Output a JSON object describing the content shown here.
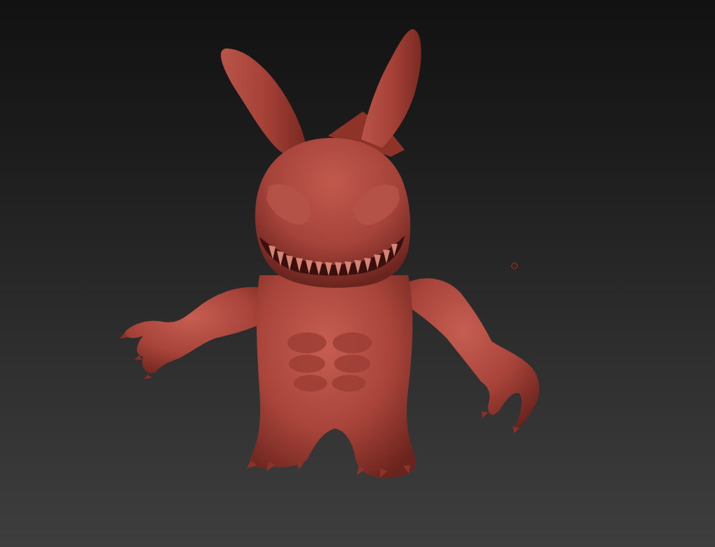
{
  "canvas": {
    "background_top": "#121212",
    "background_bottom": "#3e3e3e"
  },
  "model": {
    "material_color": "#a8443a",
    "highlight_color": "#c8665a",
    "shadow_color": "#5a1d18",
    "mouth_color": "#2a0a08",
    "teeth_color": "#d88a7a"
  },
  "cursor": {
    "color": "#b02c24"
  }
}
